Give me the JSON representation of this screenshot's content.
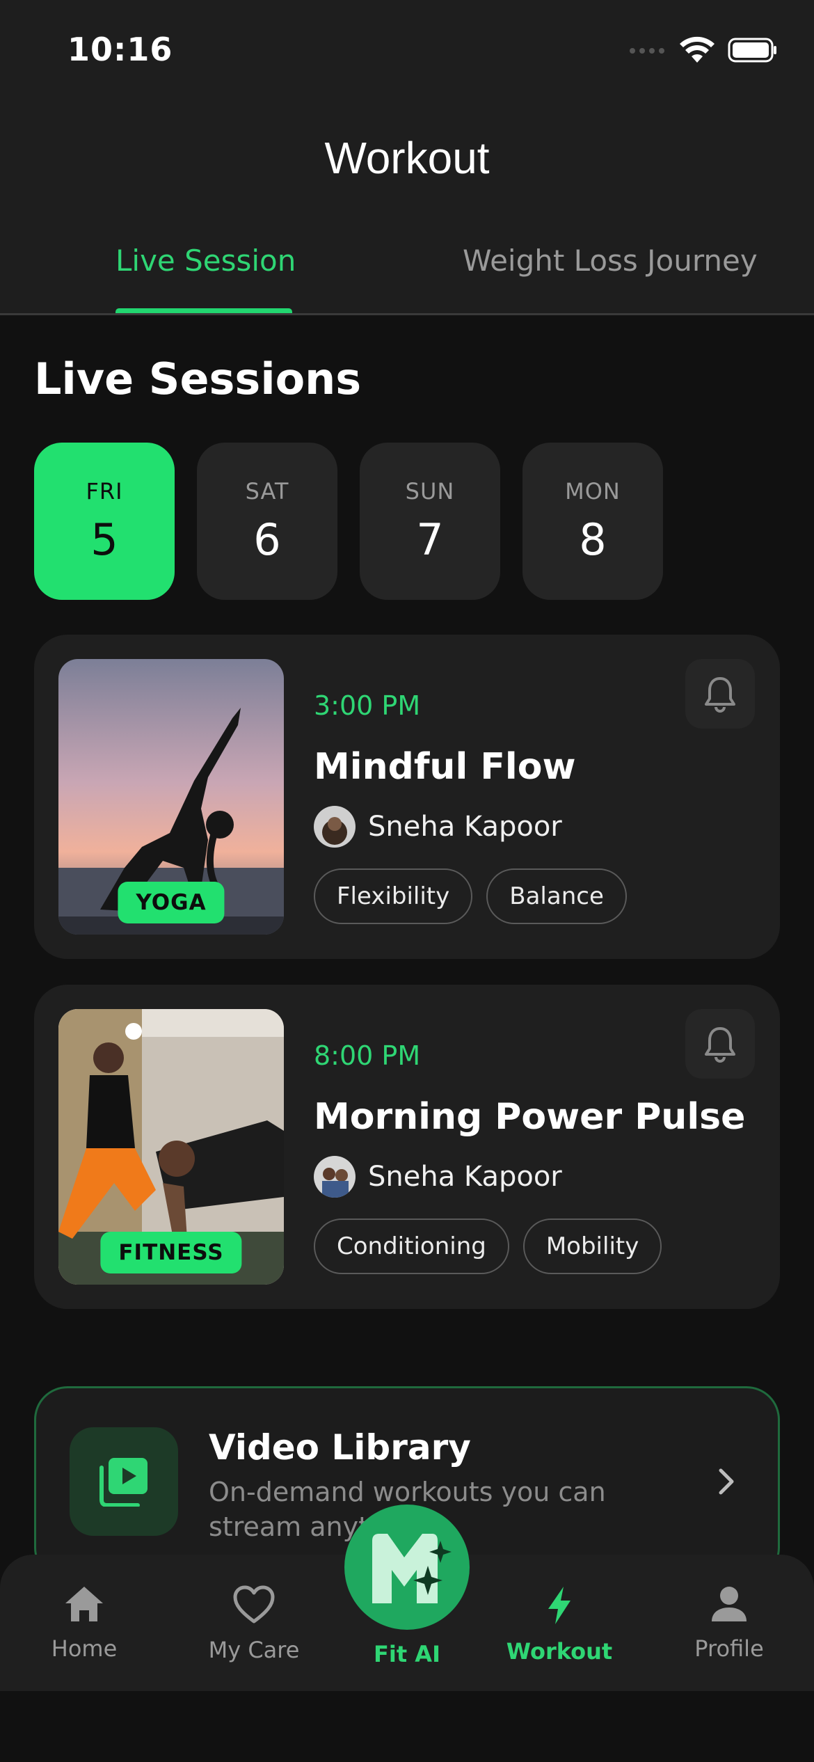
{
  "status_bar": {
    "time": "10:16"
  },
  "header": {
    "title": "Workout"
  },
  "tabs": [
    {
      "label": "Live Session",
      "active": true
    },
    {
      "label": "Weight Loss Journey",
      "active": false
    }
  ],
  "section": {
    "title": "Live Sessions"
  },
  "days": [
    {
      "name": "FRI",
      "num": "5",
      "selected": true
    },
    {
      "name": "SAT",
      "num": "6",
      "selected": false
    },
    {
      "name": "SUN",
      "num": "7",
      "selected": false
    },
    {
      "name": "MON",
      "num": "8",
      "selected": false
    }
  ],
  "sessions": [
    {
      "time": "3:00 PM",
      "name": "Mindful Flow",
      "coach": "Sneha Kapoor",
      "category": "YOGA",
      "tags": [
        "Flexibility",
        "Balance"
      ]
    },
    {
      "time": "8:00 PM",
      "name": "Morning Power Pulse",
      "coach": "Sneha Kapoor",
      "category": "FITNESS",
      "tags": [
        "Conditioning",
        "Mobility"
      ]
    }
  ],
  "library": {
    "title": "Video Library",
    "subtitle": "On-demand workouts you can stream anytime"
  },
  "nav": {
    "home": "Home",
    "care": "My Care",
    "fit_ai": "Fit AI",
    "workout": "Workout",
    "profile": "Profile"
  },
  "colors": {
    "accent": "#22e06f",
    "background": "#111111",
    "card": "#1f1f1f"
  }
}
